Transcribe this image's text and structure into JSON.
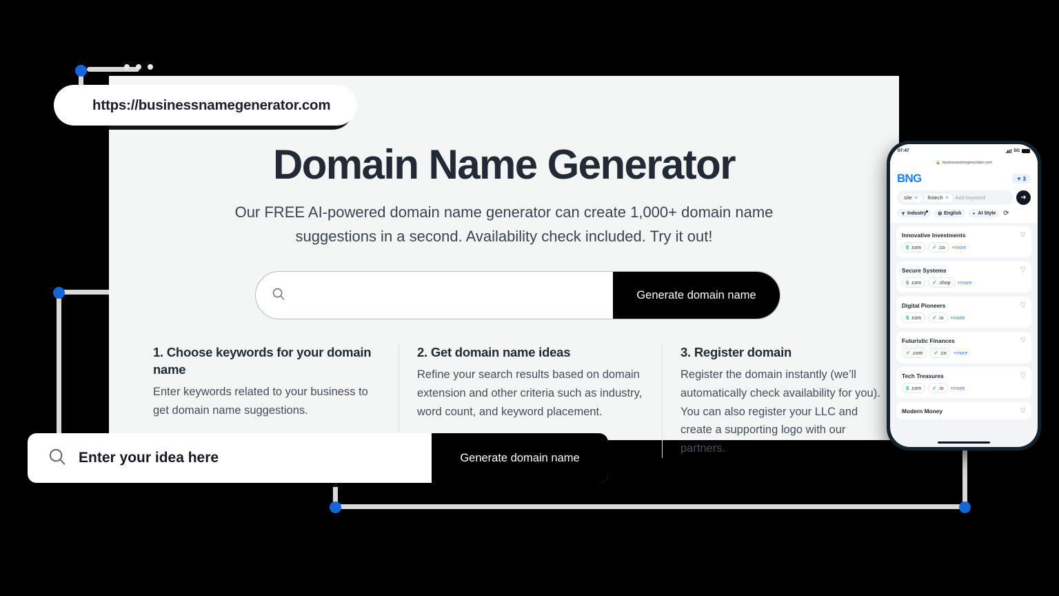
{
  "browser": {
    "url": "https://businessnamegenerator.com",
    "window_dots": 3
  },
  "hero": {
    "title": "Domain Name Generator",
    "subtitle": "Our FREE AI-powered domain name generator can create 1,000+ domain name suggestions in a second. Availability check included. Try it out!"
  },
  "hero_search": {
    "placeholder": "",
    "value": "",
    "button_label": "Generate domain name",
    "search_icon": "search-icon"
  },
  "steps": [
    {
      "title": "1. Choose keywords for your domain name",
      "body": "Enter keywords related to your business to get domain name suggestions."
    },
    {
      "title": "2. Get domain name ideas",
      "body": "Refine your search results based on domain extension and other criteria such as industry, word count, and keyword placement."
    },
    {
      "title": "3. Register domain",
      "body": "Register the domain instantly (we’ll automatically check availability for you). You can also register your LLC and create a supporting logo with our partners."
    }
  ],
  "callout_search": {
    "placeholder": "Enter your idea here",
    "value": "",
    "button_label": "Generate domain name",
    "search_icon": "search-icon"
  },
  "phone": {
    "status": {
      "time": "07:47",
      "network": "5G",
      "signal_icon": "signal-bars-icon",
      "battery_icon": "battery-icon"
    },
    "url": "businessnamegenerator.com",
    "lock_icon": "lock-icon",
    "logo": "BNG",
    "favorites": {
      "heart_icon": "heart-filled-icon",
      "count": "3"
    },
    "keywords": [
      {
        "label": "site",
        "remove_icon": "close-icon"
      },
      {
        "label": "fintech",
        "remove_icon": "close-icon"
      }
    ],
    "keyword_placeholder": "Add keyword",
    "go_icon": "arrow-right-icon",
    "filters": [
      {
        "label": "Industry",
        "icon": "filter-icon",
        "badge": true
      },
      {
        "label": "English",
        "icon": "globe-icon",
        "badge": false
      },
      {
        "label": "AI Style",
        "icon": "bolt-icon",
        "badge": false
      }
    ],
    "refresh_icon": "refresh-icon",
    "results": [
      {
        "name": "Innovative Investments",
        "heart_icon": "heart-outline-icon",
        "extensions": [
          {
            "mark": "$",
            "label": ".com"
          },
          {
            "mark": "✓",
            "label": ".co"
          }
        ],
        "more_label": "+more"
      },
      {
        "name": "Secure Systems",
        "heart_icon": "heart-outline-icon",
        "extensions": [
          {
            "mark": "$",
            "label": ".com"
          },
          {
            "mark": "✓",
            "label": ".shop"
          }
        ],
        "more_label": "+more"
      },
      {
        "name": "Digital Pioneers",
        "heart_icon": "heart-outline-icon",
        "extensions": [
          {
            "mark": "$",
            "label": ".com"
          },
          {
            "mark": "✓",
            "label": ".io"
          }
        ],
        "more_label": "+more"
      },
      {
        "name": "Futuristic Finances",
        "heart_icon": "heart-outline-icon",
        "extensions": [
          {
            "mark": "✓",
            "label": ".com"
          },
          {
            "mark": "✓",
            "label": ".co"
          }
        ],
        "more_label": "+more"
      },
      {
        "name": "Tech Treasures",
        "heart_icon": "heart-outline-icon",
        "extensions": [
          {
            "mark": "$",
            "label": ".com"
          },
          {
            "mark": "✓",
            "label": ".io"
          }
        ],
        "more_label": "+more"
      },
      {
        "name": "Modern Money",
        "heart_icon": "heart-outline-icon",
        "extensions": [],
        "more_label": ""
      }
    ]
  },
  "colors": {
    "background": "#000000",
    "card": "#f4f5f5",
    "accent_blue": "#1565d8",
    "brand_blue": "#1f7cf2",
    "available_green": "#22bb55",
    "dark": "#222a35"
  }
}
